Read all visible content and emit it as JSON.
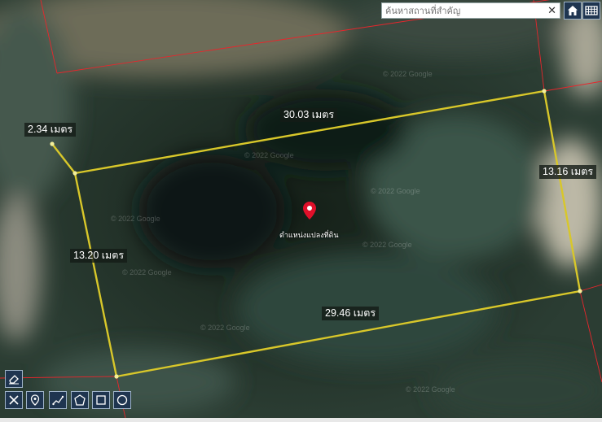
{
  "search": {
    "placeholder": "ค้นหาสถานที่สำคัญ",
    "clear_label": "✕"
  },
  "top_buttons": [
    {
      "icon": "home-icon"
    },
    {
      "icon": "grid-icon"
    }
  ],
  "measurements": {
    "top": "30.03 เมตร",
    "right": "13.16 เมตร",
    "bottom": "29.46 เมตร",
    "left": "13.20 เมตร",
    "extra": "2.34 เมตร"
  },
  "marker": {
    "label": "ตำแหน่งแปลงที่ดิน",
    "color": "#e0102a"
  },
  "watermark": "© 2022 Google",
  "colors": {
    "boundary": "#d8c72a",
    "parcel_grid": "#e8262c",
    "toolbar": "#1f3550"
  },
  "toolbar_icons": [
    "eraser-icon",
    "clear-measure-icon",
    "pin-icon",
    "polyline-icon",
    "polygon-icon",
    "rectangle-icon",
    "circle-icon"
  ]
}
